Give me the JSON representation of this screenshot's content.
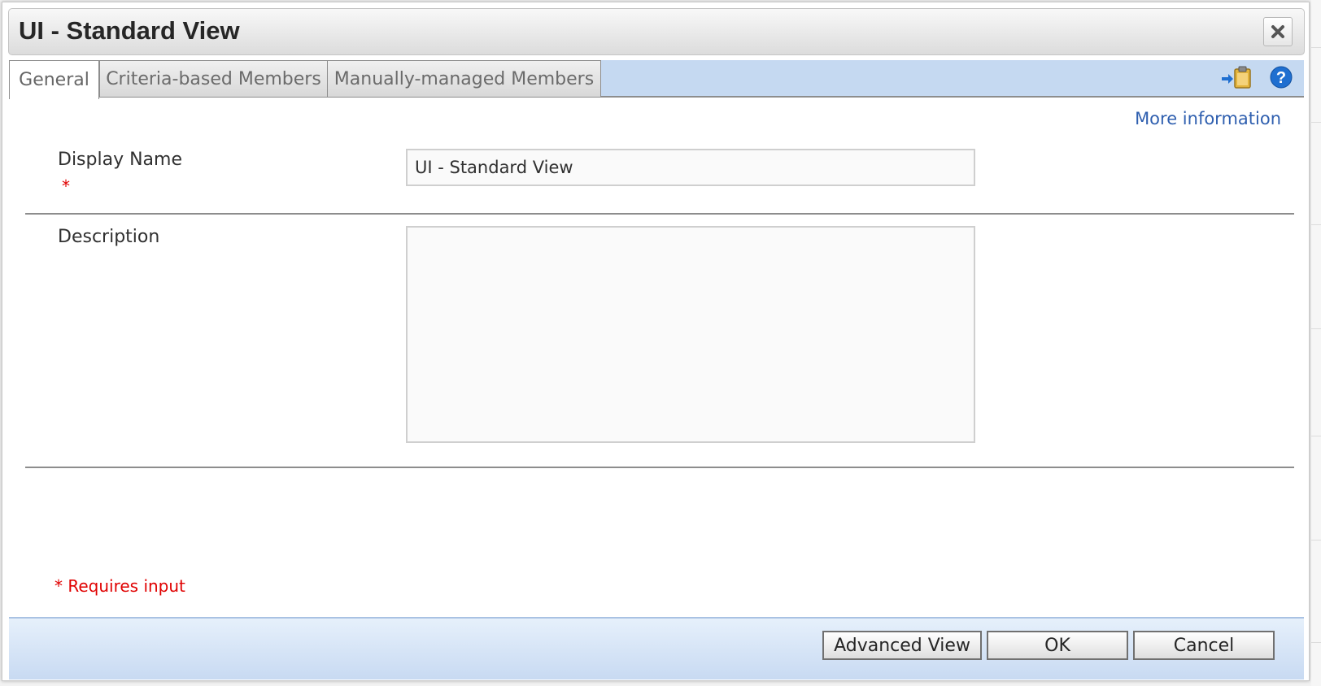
{
  "dialog": {
    "title": "UI - Standard View",
    "close_icon": "close-icon"
  },
  "tabs": [
    {
      "label": "General",
      "active": true
    },
    {
      "label": "Criteria-based Members",
      "active": false
    },
    {
      "label": "Manually-managed Members",
      "active": false
    }
  ],
  "toolbar_icons": [
    "paste-icon",
    "help-icon"
  ],
  "more_information_link": "More information",
  "form": {
    "display_name": {
      "label": "Display Name",
      "required_marker": "*",
      "value": "UI - Standard View"
    },
    "description": {
      "label": "Description",
      "value": ""
    }
  },
  "requires_input_note": "* Requires input",
  "footer": {
    "advanced_view_label": "Advanced View",
    "ok_label": "OK",
    "cancel_label": "Cancel"
  },
  "colors": {
    "tabstrip_bg": "#c5d9f1",
    "link": "#2f5faf",
    "required": "#e00000",
    "help_icon": "#1f6fd0",
    "clipboard_icon": "#e2b33c"
  }
}
